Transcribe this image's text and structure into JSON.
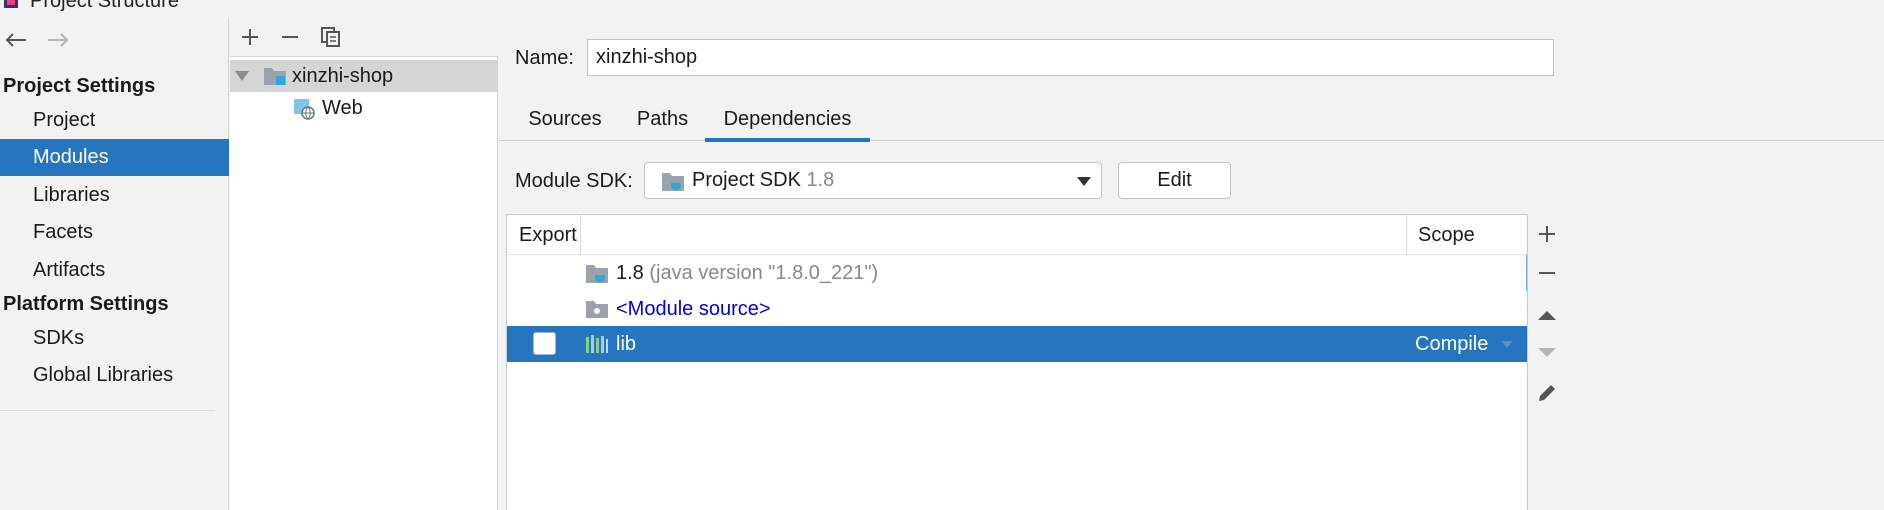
{
  "window": {
    "title": "Project Structure"
  },
  "nav": {
    "project_settings_title": "Project Settings",
    "project_items": [
      {
        "label": "Project"
      },
      {
        "label": "Modules",
        "selected": true
      },
      {
        "label": "Libraries"
      },
      {
        "label": "Facets"
      },
      {
        "label": "Artifacts"
      }
    ],
    "platform_settings_title": "Platform Settings",
    "platform_items": [
      {
        "label": "SDKs"
      },
      {
        "label": "Global Libraries"
      }
    ]
  },
  "tree": {
    "toolbar": {
      "add_icon": "plus-icon",
      "remove_icon": "minus-icon",
      "copy_icon": "copy-icon"
    },
    "module_name": "xinzhi-shop",
    "facet_name": "Web"
  },
  "module": {
    "name_label": "Name:",
    "name_value": "xinzhi-shop",
    "tabs": [
      {
        "label": "Sources"
      },
      {
        "label": "Paths"
      },
      {
        "label": "Dependencies",
        "active": true
      }
    ],
    "sdk_label": "Module SDK:",
    "sdk_value": "Project SDK",
    "sdk_version": "1.8",
    "edit_label": "Edit"
  },
  "dependencies": {
    "columns": {
      "export": "Export",
      "scope": "Scope"
    },
    "rows": [
      {
        "name": "1.8",
        "detail": "(java version \"1.8.0_221\")",
        "icon": "jdk-folder-icon"
      },
      {
        "name": "<Module source>",
        "icon": "module-source-icon"
      },
      {
        "name": "lib",
        "scope": "Compile",
        "exported": false,
        "selected": true,
        "icon": "library-icon"
      }
    ]
  },
  "colors": {
    "accent": "#2675bf",
    "link": "#0000dd",
    "muted": "#888888"
  }
}
